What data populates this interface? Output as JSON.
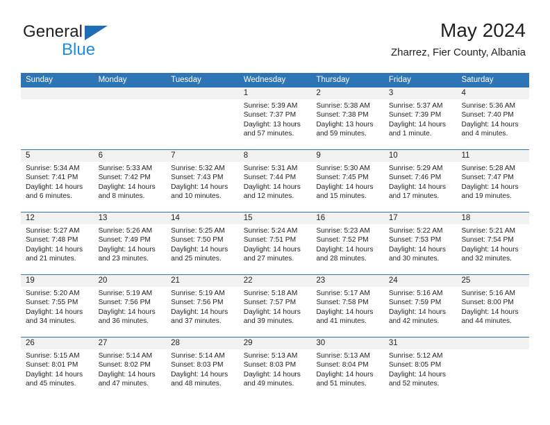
{
  "brand": {
    "line1": "General",
    "line2": "Blue",
    "accent_color": "#1f8ddd",
    "triangle_color": "#1f6eb5"
  },
  "header": {
    "title": "May 2024",
    "subtitle": "Zharrez, Fier County, Albania"
  },
  "calendar": {
    "header_color": "#2e75b6",
    "daynum_band_color": "#f2f2f2",
    "weekdays": [
      "Sunday",
      "Monday",
      "Tuesday",
      "Wednesday",
      "Thursday",
      "Friday",
      "Saturday"
    ],
    "labels": {
      "sunrise": "Sunrise:",
      "sunset": "Sunset:",
      "daylight": "Daylight:"
    },
    "weeks": [
      [
        {
          "day": "",
          "empty": true
        },
        {
          "day": "",
          "empty": true
        },
        {
          "day": "",
          "empty": true
        },
        {
          "day": "1",
          "sunrise": "Sunrise: 5:39 AM",
          "sunset": "Sunset: 7:37 PM",
          "daylight": "Daylight: 13 hours and 57 minutes."
        },
        {
          "day": "2",
          "sunrise": "Sunrise: 5:38 AM",
          "sunset": "Sunset: 7:38 PM",
          "daylight": "Daylight: 13 hours and 59 minutes."
        },
        {
          "day": "3",
          "sunrise": "Sunrise: 5:37 AM",
          "sunset": "Sunset: 7:39 PM",
          "daylight": "Daylight: 14 hours and 1 minute."
        },
        {
          "day": "4",
          "sunrise": "Sunrise: 5:36 AM",
          "sunset": "Sunset: 7:40 PM",
          "daylight": "Daylight: 14 hours and 4 minutes."
        }
      ],
      [
        {
          "day": "5",
          "sunrise": "Sunrise: 5:34 AM",
          "sunset": "Sunset: 7:41 PM",
          "daylight": "Daylight: 14 hours and 6 minutes."
        },
        {
          "day": "6",
          "sunrise": "Sunrise: 5:33 AM",
          "sunset": "Sunset: 7:42 PM",
          "daylight": "Daylight: 14 hours and 8 minutes."
        },
        {
          "day": "7",
          "sunrise": "Sunrise: 5:32 AM",
          "sunset": "Sunset: 7:43 PM",
          "daylight": "Daylight: 14 hours and 10 minutes."
        },
        {
          "day": "8",
          "sunrise": "Sunrise: 5:31 AM",
          "sunset": "Sunset: 7:44 PM",
          "daylight": "Daylight: 14 hours and 12 minutes."
        },
        {
          "day": "9",
          "sunrise": "Sunrise: 5:30 AM",
          "sunset": "Sunset: 7:45 PM",
          "daylight": "Daylight: 14 hours and 15 minutes."
        },
        {
          "day": "10",
          "sunrise": "Sunrise: 5:29 AM",
          "sunset": "Sunset: 7:46 PM",
          "daylight": "Daylight: 14 hours and 17 minutes."
        },
        {
          "day": "11",
          "sunrise": "Sunrise: 5:28 AM",
          "sunset": "Sunset: 7:47 PM",
          "daylight": "Daylight: 14 hours and 19 minutes."
        }
      ],
      [
        {
          "day": "12",
          "sunrise": "Sunrise: 5:27 AM",
          "sunset": "Sunset: 7:48 PM",
          "daylight": "Daylight: 14 hours and 21 minutes."
        },
        {
          "day": "13",
          "sunrise": "Sunrise: 5:26 AM",
          "sunset": "Sunset: 7:49 PM",
          "daylight": "Daylight: 14 hours and 23 minutes."
        },
        {
          "day": "14",
          "sunrise": "Sunrise: 5:25 AM",
          "sunset": "Sunset: 7:50 PM",
          "daylight": "Daylight: 14 hours and 25 minutes."
        },
        {
          "day": "15",
          "sunrise": "Sunrise: 5:24 AM",
          "sunset": "Sunset: 7:51 PM",
          "daylight": "Daylight: 14 hours and 27 minutes."
        },
        {
          "day": "16",
          "sunrise": "Sunrise: 5:23 AM",
          "sunset": "Sunset: 7:52 PM",
          "daylight": "Daylight: 14 hours and 28 minutes."
        },
        {
          "day": "17",
          "sunrise": "Sunrise: 5:22 AM",
          "sunset": "Sunset: 7:53 PM",
          "daylight": "Daylight: 14 hours and 30 minutes."
        },
        {
          "day": "18",
          "sunrise": "Sunrise: 5:21 AM",
          "sunset": "Sunset: 7:54 PM",
          "daylight": "Daylight: 14 hours and 32 minutes."
        }
      ],
      [
        {
          "day": "19",
          "sunrise": "Sunrise: 5:20 AM",
          "sunset": "Sunset: 7:55 PM",
          "daylight": "Daylight: 14 hours and 34 minutes."
        },
        {
          "day": "20",
          "sunrise": "Sunrise: 5:19 AM",
          "sunset": "Sunset: 7:56 PM",
          "daylight": "Daylight: 14 hours and 36 minutes."
        },
        {
          "day": "21",
          "sunrise": "Sunrise: 5:19 AM",
          "sunset": "Sunset: 7:56 PM",
          "daylight": "Daylight: 14 hours and 37 minutes."
        },
        {
          "day": "22",
          "sunrise": "Sunrise: 5:18 AM",
          "sunset": "Sunset: 7:57 PM",
          "daylight": "Daylight: 14 hours and 39 minutes."
        },
        {
          "day": "23",
          "sunrise": "Sunrise: 5:17 AM",
          "sunset": "Sunset: 7:58 PM",
          "daylight": "Daylight: 14 hours and 41 minutes."
        },
        {
          "day": "24",
          "sunrise": "Sunrise: 5:16 AM",
          "sunset": "Sunset: 7:59 PM",
          "daylight": "Daylight: 14 hours and 42 minutes."
        },
        {
          "day": "25",
          "sunrise": "Sunrise: 5:16 AM",
          "sunset": "Sunset: 8:00 PM",
          "daylight": "Daylight: 14 hours and 44 minutes."
        }
      ],
      [
        {
          "day": "26",
          "sunrise": "Sunrise: 5:15 AM",
          "sunset": "Sunset: 8:01 PM",
          "daylight": "Daylight: 14 hours and 45 minutes."
        },
        {
          "day": "27",
          "sunrise": "Sunrise: 5:14 AM",
          "sunset": "Sunset: 8:02 PM",
          "daylight": "Daylight: 14 hours and 47 minutes."
        },
        {
          "day": "28",
          "sunrise": "Sunrise: 5:14 AM",
          "sunset": "Sunset: 8:03 PM",
          "daylight": "Daylight: 14 hours and 48 minutes."
        },
        {
          "day": "29",
          "sunrise": "Sunrise: 5:13 AM",
          "sunset": "Sunset: 8:03 PM",
          "daylight": "Daylight: 14 hours and 49 minutes."
        },
        {
          "day": "30",
          "sunrise": "Sunrise: 5:13 AM",
          "sunset": "Sunset: 8:04 PM",
          "daylight": "Daylight: 14 hours and 51 minutes."
        },
        {
          "day": "31",
          "sunrise": "Sunrise: 5:12 AM",
          "sunset": "Sunset: 8:05 PM",
          "daylight": "Daylight: 14 hours and 52 minutes."
        },
        {
          "day": "",
          "empty": true
        }
      ]
    ]
  }
}
